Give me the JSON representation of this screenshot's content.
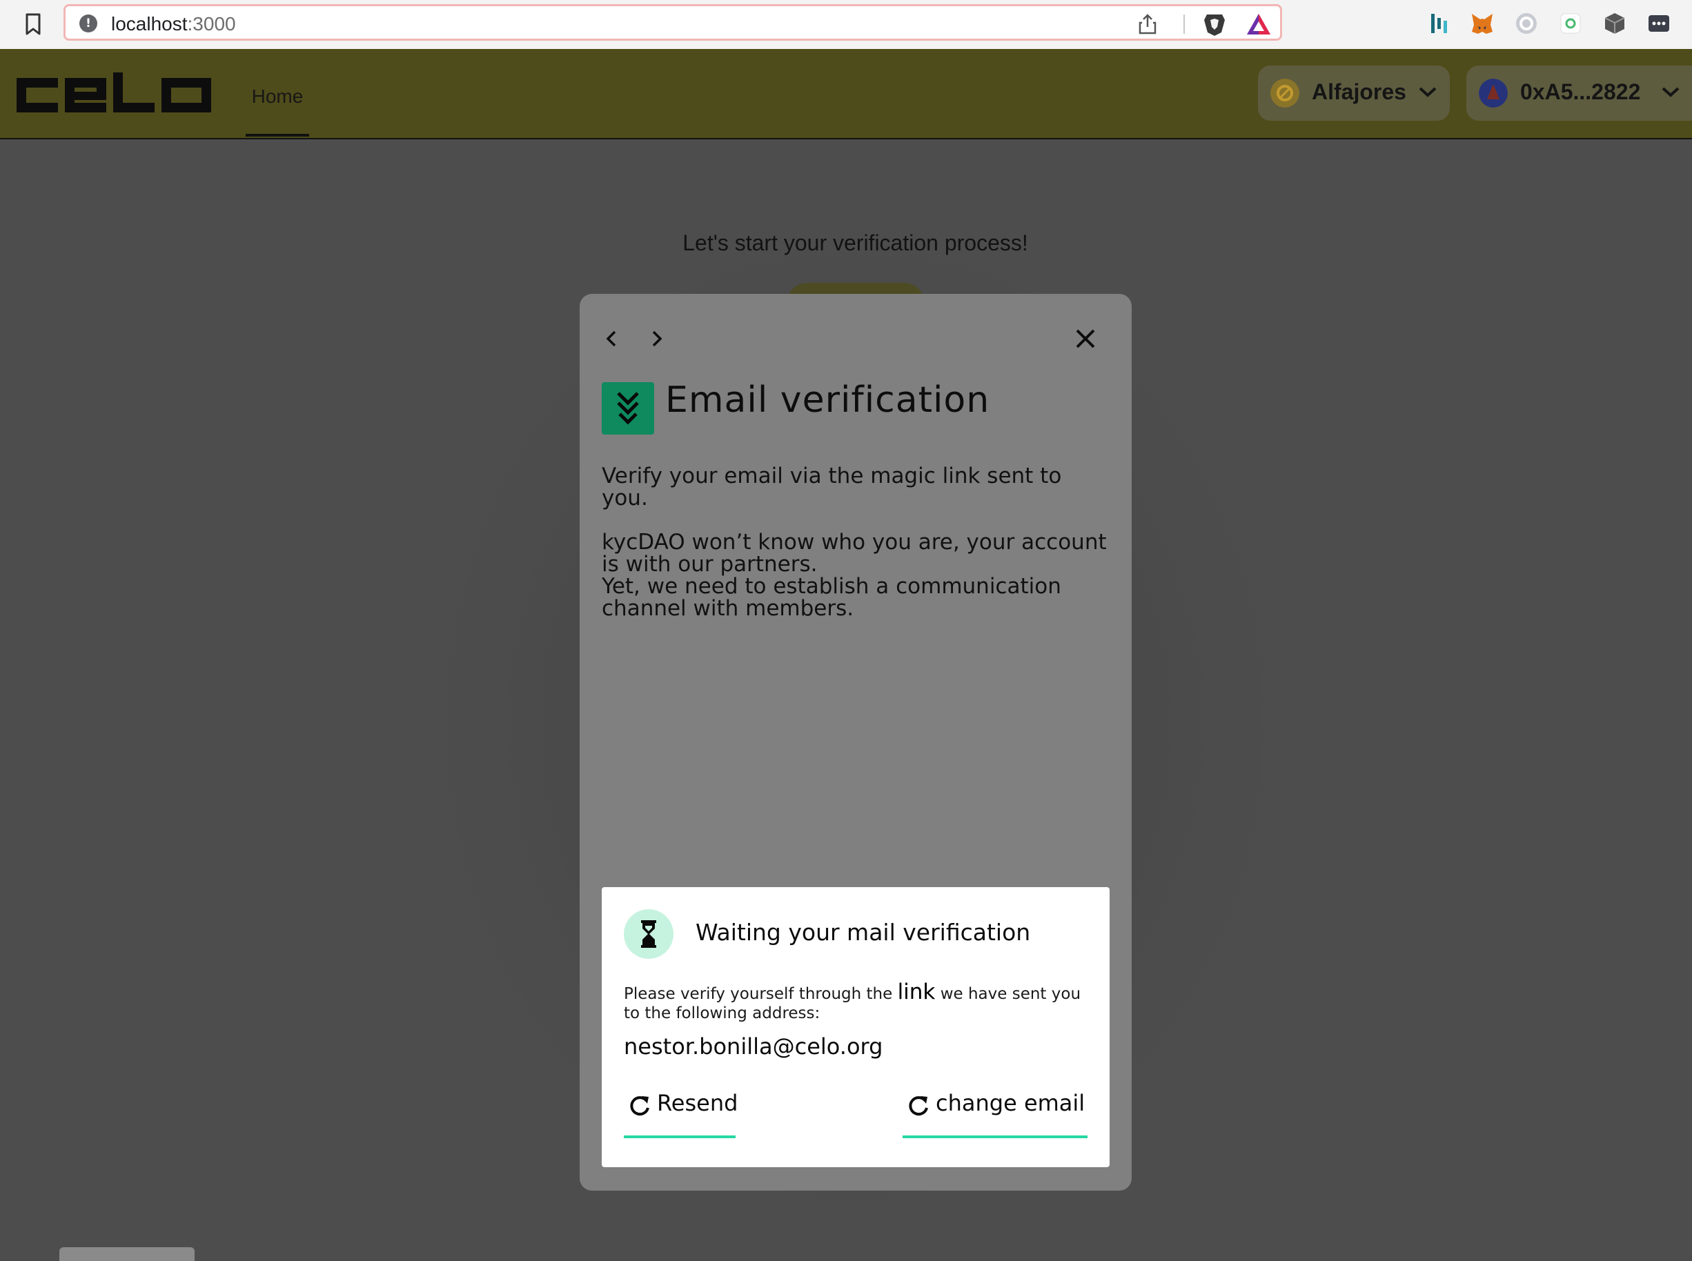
{
  "browser": {
    "url_host": "localhost",
    "url_port": ":3000"
  },
  "header": {
    "nav_home": "Home",
    "network_label": "Alfajores",
    "account_label": "0xA5...2822"
  },
  "page": {
    "heading": "Let's start your verification process!"
  },
  "modal": {
    "title": "Email verification",
    "paragraph_1": "Verify your email via the magic link sent to you.",
    "paragraph_2_line_1": "kycDAO won’t know who you are, your account is with our partners.",
    "paragraph_2_line_2": "Yet, we need to establish a communication channel with members.",
    "card": {
      "title": "Waiting your mail verification",
      "desc_before": "Please verify yourself through the ",
      "desc_link": "link",
      "desc_after": " we have sent you to the following address:",
      "email": "nestor.bonilla@celo.org",
      "resend_label": "Resend",
      "change_email_label": "change email"
    }
  },
  "colors": {
    "header_bg": "#4f4c1b",
    "modal_bg": "#808080",
    "title_icon_bg": "#0f8a5f",
    "button_underline": "#26d9a4",
    "hourglass_bg": "#c6f3df"
  },
  "icons": [
    "bookmark-icon",
    "info-icon",
    "share-icon",
    "brave-icon",
    "bat-icon",
    "chevron-left-icon",
    "chevron-right-icon",
    "close-icon",
    "kycdao-icon",
    "hourglass-icon",
    "refresh-icon"
  ]
}
